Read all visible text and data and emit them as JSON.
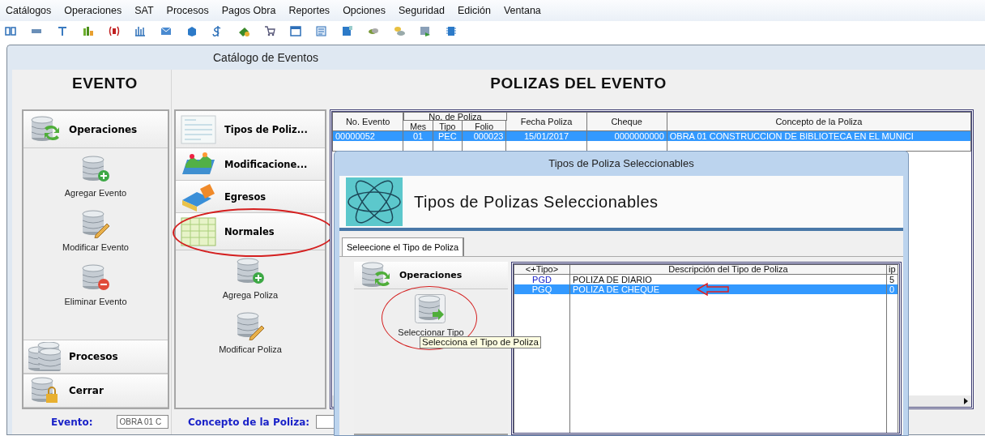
{
  "menu_bar": [
    {
      "label": "Catálogos"
    },
    {
      "label": "Operaciones"
    },
    {
      "label": "SAT"
    },
    {
      "label": "Procesos"
    },
    {
      "label": "Pagos Obra"
    },
    {
      "label": "Reportes"
    },
    {
      "label": "Opciones"
    },
    {
      "label": "Seguridad"
    },
    {
      "label": "Edición"
    },
    {
      "label": "Ventana"
    }
  ],
  "window": {
    "title": "Catálogo de Eventos",
    "left_header": "EVENTO",
    "right_header": "POLIZAS DEL EVENTO"
  },
  "event_panel": {
    "header": {
      "label": "Operaciones",
      "kind": "sync"
    },
    "actions": [
      {
        "label": "Agregar Evento",
        "kind": "add"
      },
      {
        "label": "Modificar Evento",
        "kind": "edit"
      },
      {
        "label": "Eliminar Evento",
        "kind": "delete"
      }
    ],
    "sections": [
      {
        "label": "Procesos",
        "kind": "process"
      },
      {
        "label": "Cerrar",
        "kind": "lock"
      }
    ]
  },
  "poliza_panel": {
    "categories": [
      {
        "label": "Tipos de Poliz...",
        "kind": "form",
        "circled": false
      },
      {
        "label": "Modificacione...",
        "kind": "chart",
        "circled": false
      },
      {
        "label": "Egresos",
        "kind": "books",
        "circled": false
      },
      {
        "label": "Normales",
        "kind": "sheet",
        "circled": true
      }
    ],
    "actions": [
      {
        "label": "Agrega Poliza",
        "kind": "add"
      },
      {
        "label": "Modificar Poliza",
        "kind": "edit"
      }
    ]
  },
  "polizas_table": {
    "column_group": "No. de Poliza",
    "columns": [
      {
        "label": "No. Evento",
        "grouped": false
      },
      {
        "label": "Mes",
        "grouped": true
      },
      {
        "label": "Tipo",
        "grouped": true
      },
      {
        "label": "Folio",
        "grouped": true
      },
      {
        "label": "Fecha Poliza",
        "grouped": false
      },
      {
        "label": "Cheque",
        "grouped": false
      },
      {
        "label": "Concepto de la Poliza",
        "grouped": false
      }
    ],
    "rows": [
      {
        "cells": [
          "00000052",
          "01",
          "PEC",
          "000023",
          "15/01/2017",
          "0000000000",
          "OBRA 01 CONSTRUCCION DE BIBLIOTECA EN EL MUNICI"
        ],
        "selected": true
      }
    ]
  },
  "bottom_fields": [
    {
      "label": "Evento:",
      "value": "OBRA 01 C"
    },
    {
      "label": "Concepto de la Poliza:"
    }
  ],
  "dialog": {
    "title": "Tipos de Poliza Seleccionables",
    "heading": "Tipos de Polizas Seleccionables",
    "tabs": [
      {
        "label": "Seleecione el Tipo de Poliza",
        "selected": true
      }
    ],
    "operations": {
      "header": {
        "label": "Operaciones",
        "kind": "sync"
      },
      "actions": [
        {
          "label": "Seleccionar Tipo",
          "kind": "select",
          "circled": true
        }
      ]
    },
    "tooltip": "Selecciona el Tipo de Poliza",
    "table": {
      "columns": [
        "<+Tipo>",
        "Descripción del Tipo de Poliza",
        "ip"
      ],
      "rows": [
        {
          "cells": [
            "PGD",
            "POLIZA DE DIARIO",
            "5"
          ],
          "selected": false,
          "pointed": false
        },
        {
          "cells": [
            "PGQ",
            "POLIZA DE CHEQUE",
            "0"
          ],
          "selected": true,
          "pointed": true
        }
      ]
    }
  }
}
